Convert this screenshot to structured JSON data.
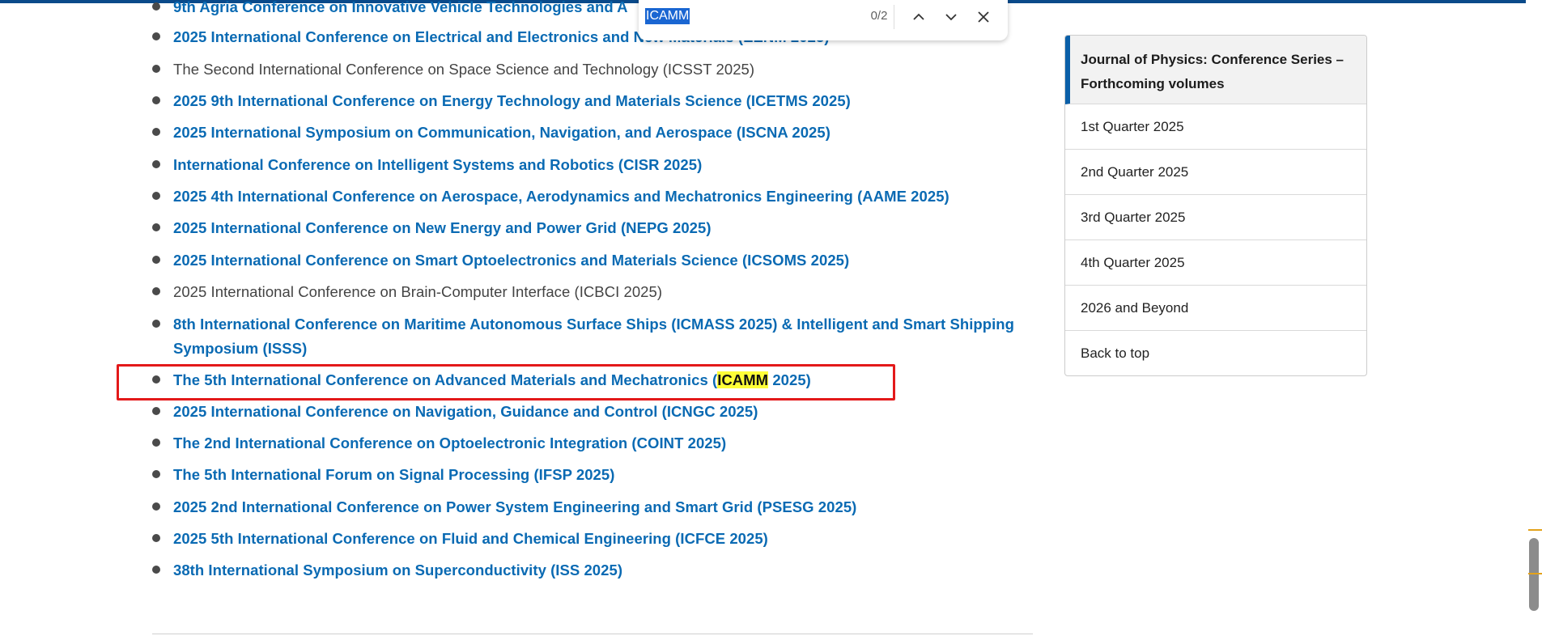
{
  "find_bar": {
    "query": "ICAMM",
    "count": "0/2"
  },
  "conferences": [
    {
      "text": "9th Agria Conference on Innovative Vehicle Technologies and A",
      "linked": true
    },
    {
      "text": "2025 International Conference on Electrical and Electronics and New Materials (EENM 2025)",
      "linked": true
    },
    {
      "text": "The Second International Conference on Space Science and Technology (ICSST 2025)",
      "linked": false
    },
    {
      "text": "2025 9th International Conference on Energy Technology and Materials Science (ICETMS 2025)",
      "linked": true
    },
    {
      "text": "2025 International Symposium on Communication, Navigation, and Aerospace (ISCNA 2025)",
      "linked": true
    },
    {
      "text": "International Conference on Intelligent Systems and Robotics (CISR 2025)",
      "linked": true
    },
    {
      "text": "2025 4th International Conference on Aerospace, Aerodynamics and Mechatronics Engineering (AAME 2025)",
      "linked": true
    },
    {
      "text": "2025 International Conference on New Energy and Power Grid (NEPG 2025)",
      "linked": true
    },
    {
      "text": "2025 International Conference on Smart Optoelectronics and Materials Science (ICSOMS 2025)",
      "linked": true
    },
    {
      "text": "2025 International Conference on Brain-Computer Interface (ICBCI 2025)",
      "linked": false
    },
    {
      "text": "8th International Conference on Maritime Autonomous Surface Ships (ICMASS 2025) & Intelligent and Smart Shipping Symposium (ISSS)",
      "linked": true
    },
    {
      "text_before": "The 5th International Conference on Advanced Materials and Mechatronics (",
      "text_match": "ICAMM",
      "text_after": " 2025)",
      "linked": true
    },
    {
      "text": "2025 International Conference on Navigation, Guidance and Control (ICNGC 2025)",
      "linked": true
    },
    {
      "text": "The 2nd International Conference on Optoelectronic Integration (COINT 2025)",
      "linked": true
    },
    {
      "text": "The 5th International Forum on Signal Processing (IFSP 2025)",
      "linked": true
    },
    {
      "text": "2025 2nd International Conference on Power System Engineering and Smart Grid (PSESG 2025)",
      "linked": true
    },
    {
      "text": "2025 5th International Conference on Fluid and Chemical Engineering (ICFCE 2025)",
      "linked": true
    },
    {
      "text": "38th International Symposium on Superconductivity (ISS 2025)",
      "linked": true
    }
  ],
  "sidebar": {
    "title": "Journal of Physics: Conference Series – Forthcoming volumes",
    "items": [
      "1st Quarter 2025",
      "2nd Quarter 2025",
      "3rd Quarter 2025",
      "4th Quarter 2025",
      "2026 and Beyond",
      "Back to top"
    ]
  },
  "colors": {
    "link": "#0a6ab3",
    "plain_text": "#444444",
    "highlight": "#ffff38",
    "annotation_box": "#e3191a",
    "find_selection": "#1a66d2",
    "sidebar_accent": "#0a5fa8"
  }
}
